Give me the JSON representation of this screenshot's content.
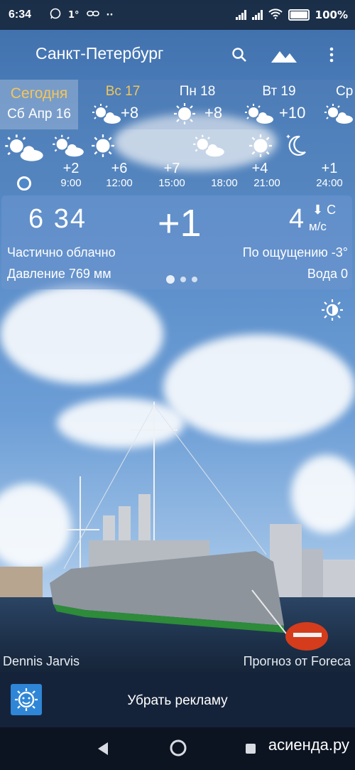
{
  "status_bar": {
    "time": "6:34",
    "temp": "1°",
    "battery": "100%",
    "icons": [
      "whatsapp-icon",
      "link-icon",
      "more-dots-icon",
      "signal-icon",
      "signal-icon",
      "wifi-icon",
      "battery-icon"
    ]
  },
  "toolbar": {
    "city": "Санкт-Петербург",
    "icons": [
      "search-icon",
      "landscape-icon",
      "overflow-menu-icon"
    ]
  },
  "days": [
    {
      "name": "Сегодня",
      "date": "Сб Апр 16",
      "selected": true
    },
    {
      "name": "Вс 17",
      "temp": "+8",
      "icon": "partly-cloudy-icon",
      "highlight": true
    },
    {
      "name": "Пн 18",
      "temp": "+8",
      "icon": "sun-icon"
    },
    {
      "name": "Вт 19",
      "temp": "+10",
      "icon": "partly-cloudy-icon"
    },
    {
      "name": "Ср",
      "icon": "partly-cloudy-icon"
    }
  ],
  "hourly": [
    {
      "temp": "+2",
      "hour": "9:00",
      "icon": "partly-cloudy-icon"
    },
    {
      "temp": "+6",
      "hour": "12:00",
      "icon": "sun-icon"
    },
    {
      "temp": "+7",
      "hour": "15:00",
      "icon": "partly-cloudy-icon"
    },
    {
      "temp": "+7",
      "hour": "18:00",
      "icon": "partly-cloudy-icon"
    },
    {
      "temp": "+4",
      "hour": "21:00",
      "icon": "sun-icon"
    },
    {
      "temp": "+1",
      "hour": "24:00",
      "icon": "moon-icon"
    }
  ],
  "current": {
    "time": "6 34",
    "temp": "+1",
    "wind_speed": "4",
    "wind_dir": "С",
    "wind_unit": "м/с",
    "condition": "Частично облачно",
    "feels_like": "По ощущению -3°",
    "pressure": "Давление 769 мм",
    "water": "Вода 0"
  },
  "credits": {
    "photo": "Dennis Jarvis",
    "forecast": "Прогноз от Foreca"
  },
  "ad": {
    "label": "Убрать рекламу"
  },
  "watermark": "асиенда.ру",
  "colors": {
    "accent": "#f2c65a",
    "ad_icon": "#2f86d6"
  }
}
